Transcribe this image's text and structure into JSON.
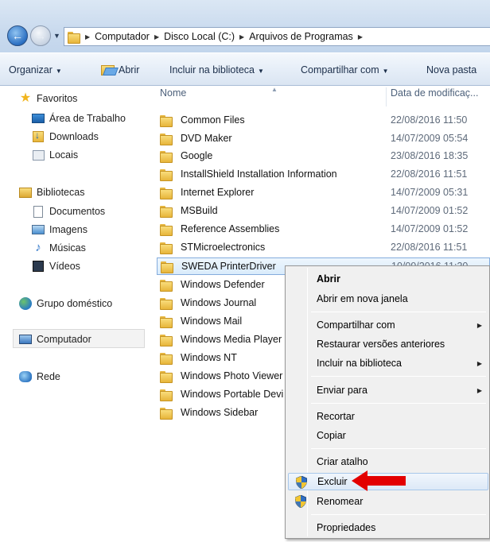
{
  "address_bar": {
    "breadcrumbs": [
      "Computador",
      "Disco Local (C:)",
      "Arquivos de Programas"
    ]
  },
  "toolbar": {
    "organize": "Organizar",
    "open": "Abrir",
    "include_library": "Incluir na biblioteca",
    "share_with": "Compartilhar com",
    "new_folder": "Nova pasta"
  },
  "navpane": {
    "favorites": "Favoritos",
    "desktop": "Área de Trabalho",
    "downloads": "Downloads",
    "places": "Locais",
    "libraries": "Bibliotecas",
    "documents": "Documentos",
    "images": "Imagens",
    "music": "Músicas",
    "videos": "Vídeos",
    "homegroup": "Grupo doméstico",
    "computer": "Computador",
    "network": "Rede"
  },
  "filelist": {
    "col_name": "Nome",
    "col_date": "Data de modificaç...",
    "rows": [
      {
        "name": "Common Files",
        "date": "22/08/2016 11:50"
      },
      {
        "name": "DVD Maker",
        "date": "14/07/2009 05:54"
      },
      {
        "name": "Google",
        "date": "23/08/2016 18:35"
      },
      {
        "name": "InstallShield Installation Information",
        "date": "22/08/2016 11:51"
      },
      {
        "name": "Internet Explorer",
        "date": "14/07/2009 05:31"
      },
      {
        "name": "MSBuild",
        "date": "14/07/2009 01:52"
      },
      {
        "name": "Reference Assemblies",
        "date": "14/07/2009 01:52"
      },
      {
        "name": "STMicroelectronics",
        "date": "22/08/2016 11:51"
      },
      {
        "name": "SWEDA PrinterDriver",
        "date": "10/09/2016 11:30"
      },
      {
        "name": "Windows Defender",
        "date": ""
      },
      {
        "name": "Windows Journal",
        "date": ""
      },
      {
        "name": "Windows Mail",
        "date": ""
      },
      {
        "name": "Windows Media Player",
        "date": ""
      },
      {
        "name": "Windows NT",
        "date": ""
      },
      {
        "name": "Windows Photo Viewer",
        "date": ""
      },
      {
        "name": "Windows Portable Devi",
        "date": ""
      },
      {
        "name": "Windows Sidebar",
        "date": ""
      }
    ]
  },
  "context_menu": {
    "open": "Abrir",
    "open_new_window": "Abrir em nova janela",
    "share_with": "Compartilhar com",
    "restore_versions": "Restaurar versões anteriores",
    "include_library": "Incluir na biblioteca",
    "send_to": "Enviar para",
    "cut": "Recortar",
    "copy": "Copiar",
    "create_shortcut": "Criar atalho",
    "delete": "Excluir",
    "rename": "Renomear",
    "properties": "Propriedades"
  },
  "colors": {
    "annotation_arrow": "#e30000",
    "selection_border": "#84acdd"
  }
}
